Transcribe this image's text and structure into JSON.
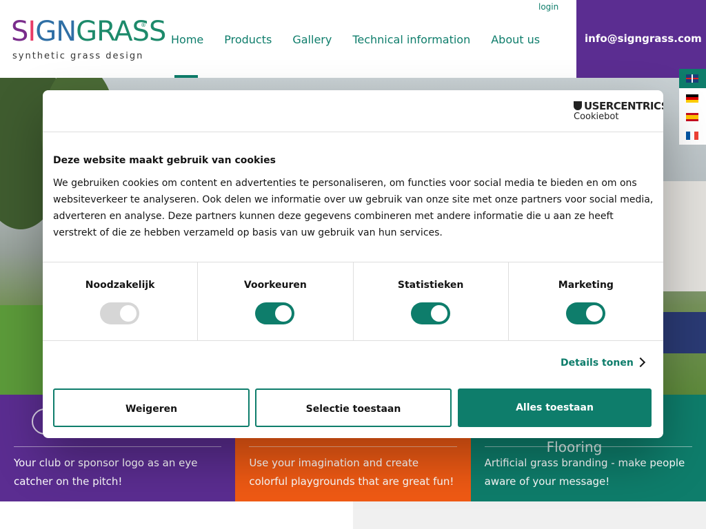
{
  "brand": {
    "logo_letters": [
      "S",
      "I",
      "G",
      "N",
      "GRASS"
    ],
    "logo_registered": "®",
    "tagline": "synthetic grass design"
  },
  "nav": {
    "items": [
      "Home",
      "Products",
      "Gallery",
      "Technical information",
      "About us"
    ],
    "active": "Home"
  },
  "header": {
    "login": "login",
    "email": "info@signgrass.com"
  },
  "languages": [
    "en",
    "de",
    "es",
    "fr"
  ],
  "tiles": [
    {
      "title": "",
      "text": "Your club or sponsor logo as an eye catcher on the pitch!",
      "color": "#5b2d91"
    },
    {
      "title": "",
      "text": "Use your imagination and create colorful playgrounds that are great fun!",
      "color": "#f05a14"
    },
    {
      "title": "Flooring",
      "text": "Artificial grass branding - make people aware of your message!",
      "color": "#0e7d6b"
    }
  ],
  "cookie": {
    "brand_name": "USERCENTRICS",
    "brand_sub": "Cookiebot",
    "heading": "Deze website maakt gebruik van cookies",
    "body": "We gebruiken cookies om content en advertenties te personaliseren, om functies voor social media te bieden en om ons websiteverkeer te analyseren. Ook delen we informatie over uw gebruik van onze site met onze partners voor social media, adverteren en analyse. Deze partners kunnen deze gegevens combineren met andere informatie die u aan ze heeft verstrekt of die ze hebben verzameld op basis van uw gebruik van hun services.",
    "categories": [
      {
        "label": "Noodzakelijk",
        "enabled": true,
        "disabled": true
      },
      {
        "label": "Voorkeuren",
        "enabled": true
      },
      {
        "label": "Statistieken",
        "enabled": true
      },
      {
        "label": "Marketing",
        "enabled": true
      }
    ],
    "details": "Details tonen",
    "buttons": {
      "reject": "Weigeren",
      "selection": "Selectie toestaan",
      "accept_all": "Alles toestaan"
    },
    "accent_color": "#0e7d6b"
  }
}
